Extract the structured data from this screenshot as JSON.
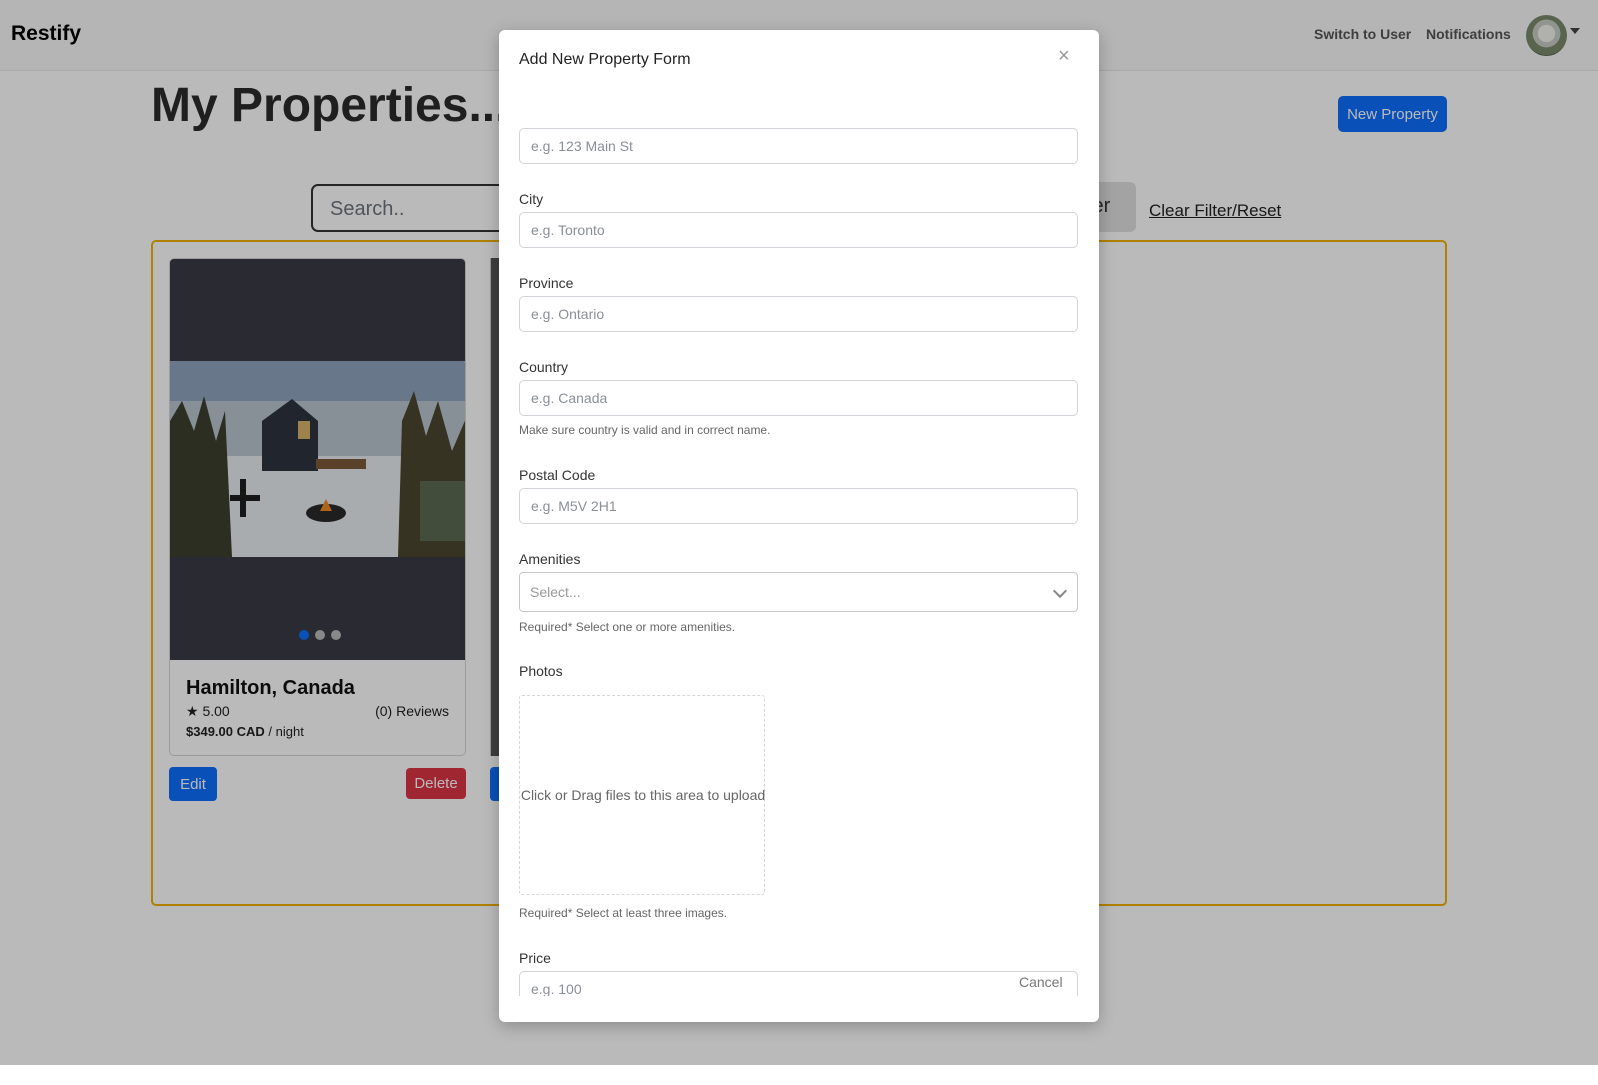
{
  "navbar": {
    "brand": "Restify",
    "switch_link": "Switch to User",
    "notifications_link": "Notifications"
  },
  "page": {
    "title": "My Properties...",
    "new_property_button": "New Property",
    "search_placeholder": "Search..",
    "filter_button_partial": "ter",
    "clear_filter_link": "Clear Filter/Reset"
  },
  "property_card": {
    "city": "Hamilton, Canada",
    "rating": "5.00",
    "reviews": "(0) Reviews",
    "price": "$349.00 CAD",
    "price_unit": "/ night",
    "edit_button": "Edit",
    "delete_button": "Delete",
    "carousel_active_index": 0,
    "carousel_count": 3
  },
  "modal": {
    "title": "Add New Property Form",
    "address_placeholder": "e.g. 123 Main St",
    "city": {
      "label": "City",
      "placeholder": "e.g. Toronto"
    },
    "province": {
      "label": "Province",
      "placeholder": "e.g. Ontario"
    },
    "country": {
      "label": "Country",
      "placeholder": "e.g. Canada",
      "help": "Make sure country is valid and in correct name."
    },
    "postal": {
      "label": "Postal Code",
      "placeholder": "e.g. M5V 2H1"
    },
    "amenities": {
      "label": "Amenities",
      "placeholder": "Select...",
      "help": "Required* Select one or more amenities."
    },
    "photos": {
      "label": "Photos",
      "dropzone_text": "Click or Drag files to this area to upload",
      "help": "Required* Select at least three images."
    },
    "price": {
      "label": "Price",
      "placeholder": "e.g. 100"
    },
    "cancel_button": "Cancel"
  },
  "colors": {
    "primary": "#0d6efd",
    "danger": "#dc3545",
    "frame_accent": "#f2b100",
    "backdrop": "rgba(0,0,0,0.27)"
  }
}
